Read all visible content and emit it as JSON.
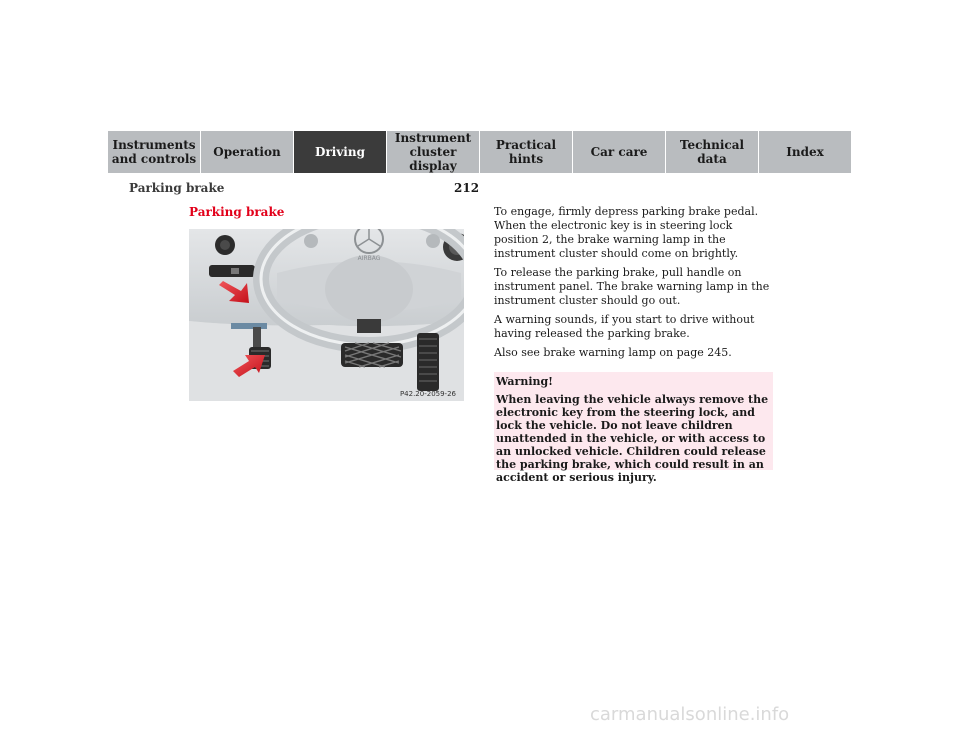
{
  "nav": {
    "tabs": [
      {
        "label": "Instruments\nand controls",
        "active": false
      },
      {
        "label": "Operation",
        "active": false
      },
      {
        "label": "Driving",
        "active": true
      },
      {
        "label": "Instrument\ncluster display",
        "active": false
      },
      {
        "label": "Practical hints",
        "active": false
      },
      {
        "label": "Car care",
        "active": false
      },
      {
        "label": "Technical\ndata",
        "active": false
      },
      {
        "label": "Index",
        "active": false
      }
    ]
  },
  "page": {
    "number": "212",
    "running_title": "Parking brake",
    "section_title": "Parking brake"
  },
  "figure": {
    "caption": "P42.20-2059-26",
    "airbag_label": "AIRBAG"
  },
  "body": {
    "paragraphs": [
      "To engage, firmly depress parking brake pedal. When the electronic key is in steering lock position 2, the brake warning lamp in the instrument cluster should come on brightly.",
      "To release the parking brake, pull handle on instrument panel. The brake warning lamp in the instrument cluster should go out.",
      "A warning sounds, if you start to drive without having released the parking brake.",
      "Also see brake warning lamp on page 245."
    ]
  },
  "warning": {
    "title": "Warning!",
    "text": "When leaving the vehicle always remove the electronic key from the steering lock, and lock the vehicle. Do not leave children unattended in the vehicle, or with access to an unlocked vehicle. Children could release the parking brake, which could result in an accident or serious injury."
  },
  "footer": {
    "watermark": "carmanualsonline.info"
  },
  "colors": {
    "nav_inactive": "#b9bcbf",
    "nav_active": "#3b3b3b",
    "accent_red": "#e2001a",
    "warning_bg": "#fde8ee"
  }
}
